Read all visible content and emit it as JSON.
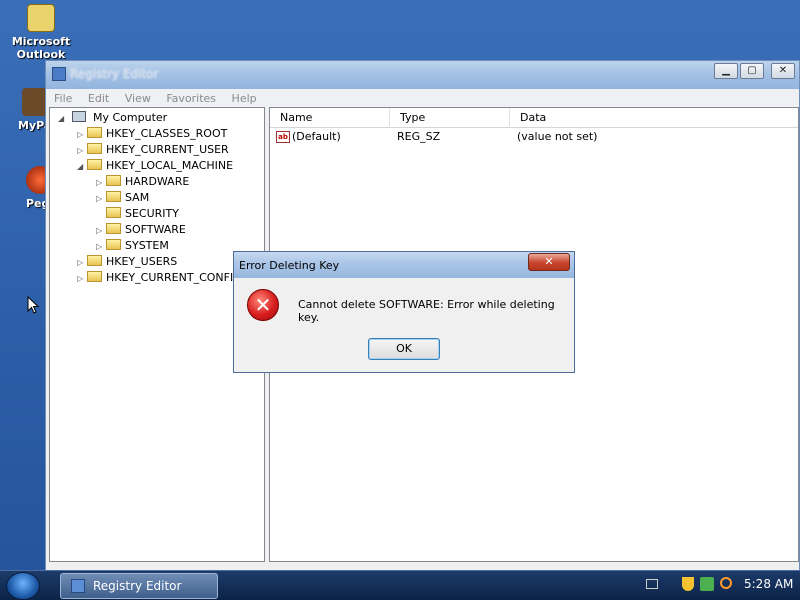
{
  "desktop": {
    "icons": [
      {
        "label1": "Microsoft",
        "label2": "Outlook"
      },
      {
        "label1": "MyPa",
        "label2": ""
      },
      {
        "label1": "Peg",
        "label2": ""
      }
    ]
  },
  "window": {
    "title": "Registry Editor",
    "menu": [
      "File",
      "Edit",
      "View",
      "Favorites",
      "Help"
    ],
    "tree": [
      {
        "label": "My Computer",
        "exp": "◢"
      },
      {
        "label": "HKEY_CLASSES_ROOT",
        "exp": "▷"
      },
      {
        "label": "HKEY_CURRENT_USER",
        "exp": "▷"
      },
      {
        "label": "HKEY_LOCAL_MACHINE",
        "exp": "◢"
      },
      {
        "label": "HARDWARE",
        "exp": "▷"
      },
      {
        "label": "SAM",
        "exp": "▷"
      },
      {
        "label": "SECURITY",
        "exp": ""
      },
      {
        "label": "SOFTWARE",
        "exp": "▷"
      },
      {
        "label": "SYSTEM",
        "exp": "▷"
      },
      {
        "label": "HKEY_USERS",
        "exp": "▷"
      },
      {
        "label": "HKEY_CURRENT_CONFIG",
        "exp": "▷"
      }
    ],
    "columns": [
      "Name",
      "Type",
      "Data"
    ],
    "values": [
      {
        "name": "(Default)",
        "type": "REG_SZ",
        "data": "(value not set)"
      }
    ]
  },
  "dialog": {
    "title": "Error Deleting Key",
    "message": "Cannot delete SOFTWARE:  Error while deleting key.",
    "ok_label": "OK",
    "close_label": "✕"
  },
  "taskbar": {
    "task_label": "Registry Editor",
    "clock": "5:28 AM"
  }
}
